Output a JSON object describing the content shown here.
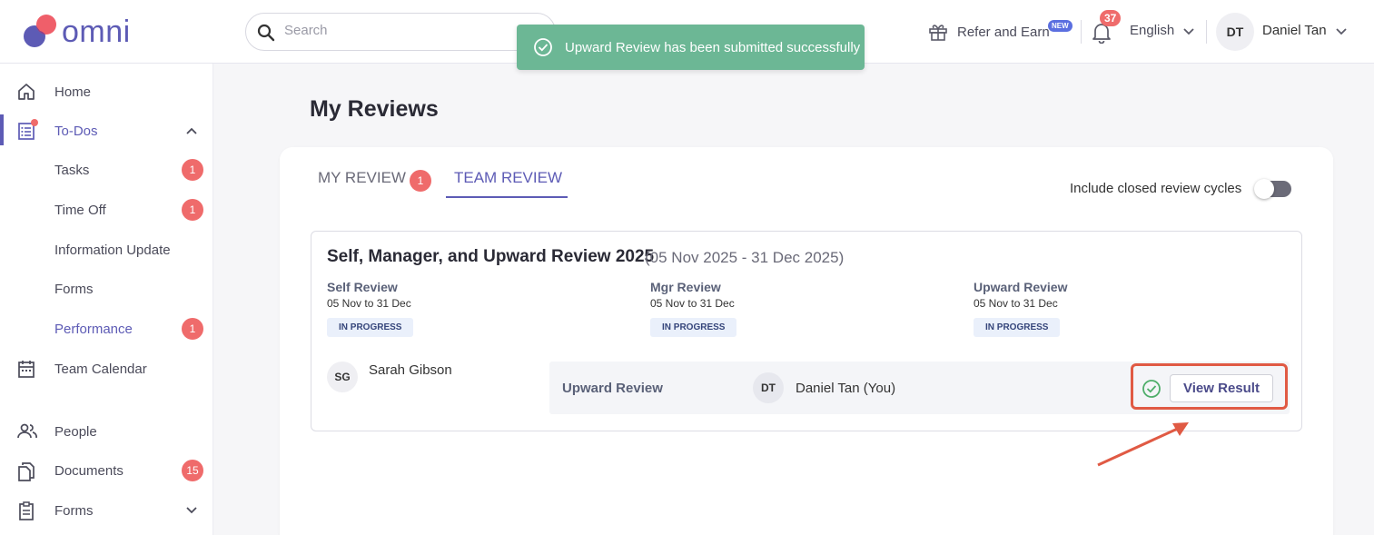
{
  "brand": {
    "name": "omni"
  },
  "search": {
    "placeholder": "Search"
  },
  "toast": {
    "message": "Upward Review has been submitted successfully"
  },
  "header": {
    "refer": "Refer and Earn",
    "refer_badge": "NEW",
    "notifications": "37",
    "language": "English",
    "user_initials": "DT",
    "user_name": "Daniel Tan"
  },
  "sidebar": {
    "items": [
      {
        "label": "Home",
        "icon": "home-icon"
      },
      {
        "label": "To-Dos",
        "icon": "todos-icon"
      },
      {
        "label": "Tasks",
        "count": "1"
      },
      {
        "label": "Time Off",
        "count": "1"
      },
      {
        "label": "Information Update"
      },
      {
        "label": "Forms"
      },
      {
        "label": "Performance",
        "count": "1"
      },
      {
        "label": "Team Calendar",
        "icon": "calendar-icon"
      },
      {
        "label": "People",
        "icon": "people-icon"
      },
      {
        "label": "Documents",
        "icon": "documents-icon",
        "count": "15"
      },
      {
        "label": "Forms",
        "icon": "clipboard-icon"
      }
    ]
  },
  "main": {
    "title": "My Reviews",
    "tabs": [
      {
        "label": "MY REVIEW",
        "count": "1"
      },
      {
        "label": "TEAM REVIEW"
      }
    ],
    "toggle_label": "Include closed review cycles",
    "cycle": {
      "title": "Self, Manager, and Upward Review 2025",
      "dates": "(05 Nov 2025 - 31 Dec 2025)",
      "stages": [
        {
          "name": "Self Review",
          "date": "05 Nov to 31 Dec",
          "status": "IN PROGRESS"
        },
        {
          "name": "Mgr Review",
          "date": "05 Nov to 31 Dec",
          "status": "IN PROGRESS"
        },
        {
          "name": "Upward Review",
          "date": "05 Nov to 31 Dec",
          "status": "IN PROGRESS"
        }
      ],
      "reviewee": {
        "initials": "SG",
        "name": "Sarah Gibson"
      },
      "row": {
        "type": "Upward Review",
        "reviewer_initials": "DT",
        "reviewer_name": "Daniel Tan (You)",
        "action": "View Result"
      }
    }
  },
  "colors": {
    "accent": "#5d5bb5",
    "badge": "#ef6b6b",
    "toast": "#6cb795",
    "highlight": "#e05a44"
  }
}
